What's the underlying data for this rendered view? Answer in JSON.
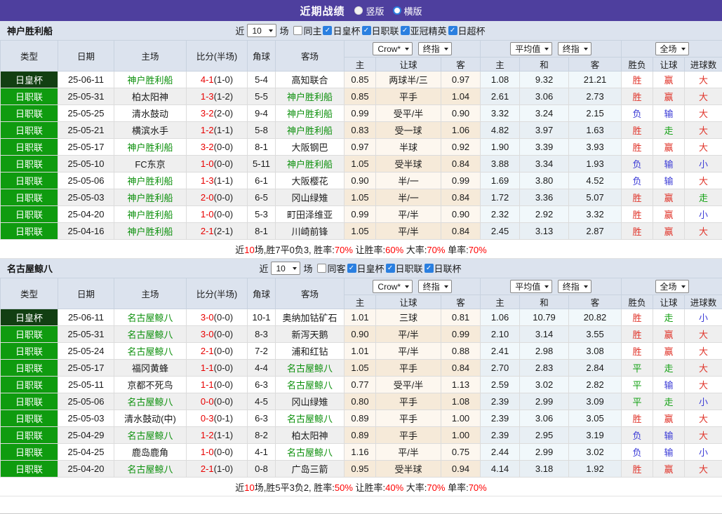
{
  "title": {
    "title": "近期战绩",
    "radios": [
      {
        "label": "竖版",
        "on": true
      },
      {
        "label": "横版",
        "on": false
      }
    ]
  },
  "colors": {
    "purple": "#4e3f9e",
    "hdr": "#dce3ee",
    "cup": "#123f12",
    "lg": "#0f9b0f",
    "team": "#0a8f0a",
    "red": "#e0352b",
    "green": "#13a113",
    "blue": "#3b3bd6",
    "scorered": "#e80000",
    "cbblue": "#2a7fe0",
    "odds1": "#fdf7ef",
    "odds2": "#f6ead9",
    "avg1": "#f1f8fb",
    "avg2": "#e8eff4",
    "rowalt": "#efefef"
  },
  "headers": {
    "main": [
      "类型",
      "日期",
      "主场",
      "比分(半场)",
      "角球",
      "客场"
    ],
    "sub": [
      "主",
      "让球",
      "客",
      "主",
      "和",
      "客",
      "胜负",
      "让球",
      "进球数"
    ],
    "sel_crow": "Crow*",
    "sel_final": "终指",
    "sel_avg": "平均值",
    "sel_scope": "全场"
  },
  "sections": [
    {
      "team": "神户胜利船",
      "filters": {
        "near": "近",
        "count": "10",
        "unit": "场",
        "same": {
          "label": "同主",
          "checked": false
        },
        "leagues": [
          {
            "label": "日皇杯",
            "checked": true
          },
          {
            "label": "日职联",
            "checked": true
          },
          {
            "label": "亚冠精英",
            "checked": true
          },
          {
            "label": "日超杯",
            "checked": true
          }
        ]
      },
      "rows": [
        {
          "type": "日皇杯",
          "tcls": "cup",
          "date": "25-06-11",
          "home": "神户胜利船",
          "hcls": "focus",
          "ft": "4-1",
          "ht": "(1-0)",
          "corner": "5-4",
          "away": "高知联合",
          "acls": "",
          "oh": "0.85",
          "hd": "两球半/三",
          "oa": "0.97",
          "ah": "1.08",
          "ad": "9.32",
          "aa": "21.21",
          "r1": "胜",
          "r1c": "red",
          "r2": "赢",
          "r2c": "red",
          "r3": "大",
          "r3c": "red"
        },
        {
          "type": "日职联",
          "tcls": "league",
          "date": "25-05-31",
          "home": "柏太阳神",
          "hcls": "",
          "ft": "1-3",
          "ht": "(1-2)",
          "corner": "5-5",
          "away": "神户胜利船",
          "acls": "focus",
          "oh": "0.85",
          "hd": "平手",
          "oa": "1.04",
          "ah": "2.61",
          "ad": "3.06",
          "aa": "2.73",
          "r1": "胜",
          "r1c": "red",
          "r2": "赢",
          "r2c": "red",
          "r3": "大",
          "r3c": "red"
        },
        {
          "type": "日职联",
          "tcls": "league",
          "date": "25-05-25",
          "home": "清水鼓动",
          "hcls": "",
          "ft": "3-2",
          "ht": "(2-0)",
          "corner": "9-4",
          "away": "神户胜利船",
          "acls": "focus",
          "oh": "0.99",
          "hd": "受平/半",
          "oa": "0.90",
          "ah": "3.32",
          "ad": "3.24",
          "aa": "2.15",
          "r1": "负",
          "r1c": "blue",
          "r2": "输",
          "r2c": "blue",
          "r3": "大",
          "r3c": "red"
        },
        {
          "type": "日职联",
          "tcls": "league",
          "date": "25-05-21",
          "home": "横滨水手",
          "hcls": "",
          "ft": "1-2",
          "ht": "(1-1)",
          "corner": "5-8",
          "away": "神户胜利船",
          "acls": "focus",
          "oh": "0.83",
          "hd": "受一球",
          "oa": "1.06",
          "ah": "4.82",
          "ad": "3.97",
          "aa": "1.63",
          "r1": "胜",
          "r1c": "red",
          "r2": "走",
          "r2c": "green",
          "r3": "大",
          "r3c": "red"
        },
        {
          "type": "日职联",
          "tcls": "league",
          "date": "25-05-17",
          "home": "神户胜利船",
          "hcls": "focus",
          "ft": "3-2",
          "ht": "(0-0)",
          "corner": "8-1",
          "away": "大阪钢巴",
          "acls": "",
          "oh": "0.97",
          "hd": "半球",
          "oa": "0.92",
          "ah": "1.90",
          "ad": "3.39",
          "aa": "3.93",
          "r1": "胜",
          "r1c": "red",
          "r2": "赢",
          "r2c": "red",
          "r3": "大",
          "r3c": "red"
        },
        {
          "type": "日职联",
          "tcls": "league",
          "date": "25-05-10",
          "home": "FC东京",
          "hcls": "",
          "ft": "1-0",
          "ht": "(0-0)",
          "corner": "5-11",
          "away": "神户胜利船",
          "acls": "focus",
          "oh": "1.05",
          "hd": "受半球",
          "oa": "0.84",
          "ah": "3.88",
          "ad": "3.34",
          "aa": "1.93",
          "r1": "负",
          "r1c": "blue",
          "r2": "输",
          "r2c": "blue",
          "r3": "小",
          "r3c": "blue"
        },
        {
          "type": "日职联",
          "tcls": "league",
          "date": "25-05-06",
          "home": "神户胜利船",
          "hcls": "focus",
          "ft": "1-3",
          "ht": "(1-1)",
          "corner": "6-1",
          "away": "大阪樱花",
          "acls": "",
          "oh": "0.90",
          "hd": "半/一",
          "oa": "0.99",
          "ah": "1.69",
          "ad": "3.80",
          "aa": "4.52",
          "r1": "负",
          "r1c": "blue",
          "r2": "输",
          "r2c": "blue",
          "r3": "大",
          "r3c": "red"
        },
        {
          "type": "日职联",
          "tcls": "league",
          "date": "25-05-03",
          "home": "神户胜利船",
          "hcls": "focus",
          "ft": "2-0",
          "ht": "(0-0)",
          "corner": "6-5",
          "away": "冈山绿雉",
          "acls": "",
          "oh": "1.05",
          "hd": "半/一",
          "oa": "0.84",
          "ah": "1.72",
          "ad": "3.36",
          "aa": "5.07",
          "r1": "胜",
          "r1c": "red",
          "r2": "赢",
          "r2c": "red",
          "r3": "走",
          "r3c": "green"
        },
        {
          "type": "日职联",
          "tcls": "league",
          "date": "25-04-20",
          "home": "神户胜利船",
          "hcls": "focus",
          "ft": "1-0",
          "ht": "(0-0)",
          "corner": "5-3",
          "away": "町田泽维亚",
          "acls": "",
          "oh": "0.99",
          "hd": "平/半",
          "oa": "0.90",
          "ah": "2.32",
          "ad": "2.92",
          "aa": "3.32",
          "r1": "胜",
          "r1c": "red",
          "r2": "赢",
          "r2c": "red",
          "r3": "小",
          "r3c": "blue"
        },
        {
          "type": "日职联",
          "tcls": "league",
          "date": "25-04-16",
          "home": "神户胜利船",
          "hcls": "focus",
          "ft": "2-1",
          "ht": "(2-1)",
          "corner": "8-1",
          "away": "川崎前锋",
          "acls": "",
          "oh": "1.05",
          "hd": "平/半",
          "oa": "0.84",
          "ah": "2.45",
          "ad": "3.13",
          "aa": "2.87",
          "r1": "胜",
          "r1c": "red",
          "r2": "赢",
          "r2c": "red",
          "r3": "大",
          "r3c": "red"
        }
      ],
      "summary": [
        {
          "text": "近"
        },
        {
          "text": "10",
          "red": true
        },
        {
          "text": "场,胜7平0负3, 胜率:"
        },
        {
          "text": "70%",
          "red": true
        },
        {
          "text": " 让胜率:"
        },
        {
          "text": "60%",
          "red": true
        },
        {
          "text": " 大率:"
        },
        {
          "text": "70%",
          "red": true
        },
        {
          "text": " 单率:"
        },
        {
          "text": "70%",
          "red": true
        }
      ]
    },
    {
      "team": "名古屋鲸八",
      "filters": {
        "near": "近",
        "count": "10",
        "unit": "场",
        "same": {
          "label": "同客",
          "checked": false
        },
        "leagues": [
          {
            "label": "日皇杯",
            "checked": true
          },
          {
            "label": "日职联",
            "checked": true
          },
          {
            "label": "日联杯",
            "checked": true
          }
        ]
      },
      "rows": [
        {
          "type": "日皇杯",
          "tcls": "cup",
          "date": "25-06-11",
          "home": "名古屋鲸八",
          "hcls": "focus",
          "ft": "3-0",
          "ht": "(0-0)",
          "corner": "10-1",
          "away": "奥纳加钴矿石",
          "acls": "",
          "oh": "1.01",
          "hd": "三球",
          "oa": "0.81",
          "ah": "1.06",
          "ad": "10.79",
          "aa": "20.82",
          "r1": "胜",
          "r1c": "red",
          "r2": "走",
          "r2c": "green",
          "r3": "小",
          "r3c": "blue"
        },
        {
          "type": "日职联",
          "tcls": "league",
          "date": "25-05-31",
          "home": "名古屋鲸八",
          "hcls": "focus",
          "ft": "3-0",
          "ht": "(0-0)",
          "corner": "8-3",
          "away": "新泻天鹅",
          "acls": "",
          "oh": "0.90",
          "hd": "平/半",
          "oa": "0.99",
          "ah": "2.10",
          "ad": "3.14",
          "aa": "3.55",
          "r1": "胜",
          "r1c": "red",
          "r2": "赢",
          "r2c": "red",
          "r3": "大",
          "r3c": "red"
        },
        {
          "type": "日职联",
          "tcls": "league",
          "date": "25-05-24",
          "home": "名古屋鲸八",
          "hcls": "focus",
          "ft": "2-1",
          "ht": "(0-0)",
          "corner": "7-2",
          "away": "浦和红钻",
          "acls": "",
          "oh": "1.01",
          "hd": "平/半",
          "oa": "0.88",
          "ah": "2.41",
          "ad": "2.98",
          "aa": "3.08",
          "r1": "胜",
          "r1c": "red",
          "r2": "赢",
          "r2c": "red",
          "r3": "大",
          "r3c": "red"
        },
        {
          "type": "日职联",
          "tcls": "league",
          "date": "25-05-17",
          "home": "福冈黄蜂",
          "hcls": "",
          "ft": "1-1",
          "ht": "(0-0)",
          "corner": "4-4",
          "away": "名古屋鲸八",
          "acls": "focus",
          "oh": "1.05",
          "hd": "平手",
          "oa": "0.84",
          "ah": "2.70",
          "ad": "2.83",
          "aa": "2.84",
          "r1": "平",
          "r1c": "green",
          "r2": "走",
          "r2c": "green",
          "r3": "大",
          "r3c": "red"
        },
        {
          "type": "日职联",
          "tcls": "league",
          "date": "25-05-11",
          "home": "京都不死鸟",
          "hcls": "",
          "ft": "1-1",
          "ht": "(0-0)",
          "corner": "6-3",
          "away": "名古屋鲸八",
          "acls": "focus",
          "oh": "0.77",
          "hd": "受平/半",
          "oa": "1.13",
          "ah": "2.59",
          "ad": "3.02",
          "aa": "2.82",
          "r1": "平",
          "r1c": "green",
          "r2": "输",
          "r2c": "blue",
          "r3": "大",
          "r3c": "red"
        },
        {
          "type": "日职联",
          "tcls": "league",
          "date": "25-05-06",
          "home": "名古屋鲸八",
          "hcls": "focus",
          "ft": "0-0",
          "ht": "(0-0)",
          "corner": "4-5",
          "away": "冈山绿雉",
          "acls": "",
          "oh": "0.80",
          "hd": "平手",
          "oa": "1.08",
          "ah": "2.39",
          "ad": "2.99",
          "aa": "3.09",
          "r1": "平",
          "r1c": "green",
          "r2": "走",
          "r2c": "green",
          "r3": "小",
          "r3c": "blue"
        },
        {
          "type": "日职联",
          "tcls": "league",
          "date": "25-05-03",
          "home": "清水鼓动(中)",
          "hcls": "",
          "ft": "0-3",
          "ht": "(0-1)",
          "corner": "6-3",
          "away": "名古屋鲸八",
          "acls": "focus",
          "oh": "0.89",
          "hd": "平手",
          "oa": "1.00",
          "ah": "2.39",
          "ad": "3.06",
          "aa": "3.05",
          "r1": "胜",
          "r1c": "red",
          "r2": "赢",
          "r2c": "red",
          "r3": "大",
          "r3c": "red"
        },
        {
          "type": "日职联",
          "tcls": "league",
          "date": "25-04-29",
          "home": "名古屋鲸八",
          "hcls": "focus",
          "ft": "1-2",
          "ht": "(1-1)",
          "corner": "8-2",
          "away": "柏太阳神",
          "acls": "",
          "oh": "0.89",
          "hd": "平手",
          "oa": "1.00",
          "ah": "2.39",
          "ad": "2.95",
          "aa": "3.19",
          "r1": "负",
          "r1c": "blue",
          "r2": "输",
          "r2c": "blue",
          "r3": "大",
          "r3c": "red"
        },
        {
          "type": "日职联",
          "tcls": "league",
          "date": "25-04-25",
          "home": "鹿岛鹿角",
          "hcls": "",
          "ft": "1-0",
          "ht": "(0-0)",
          "corner": "4-1",
          "away": "名古屋鲸八",
          "acls": "focus",
          "oh": "1.16",
          "hd": "平/半",
          "oa": "0.75",
          "ah": "2.44",
          "ad": "2.99",
          "aa": "3.02",
          "r1": "负",
          "r1c": "blue",
          "r2": "输",
          "r2c": "blue",
          "r3": "小",
          "r3c": "blue"
        },
        {
          "type": "日职联",
          "tcls": "league",
          "date": "25-04-20",
          "home": "名古屋鲸八",
          "hcls": "focus",
          "ft": "2-1",
          "ht": "(1-0)",
          "corner": "0-8",
          "away": "广岛三箭",
          "acls": "",
          "oh": "0.95",
          "hd": "受半球",
          "oa": "0.94",
          "ah": "4.14",
          "ad": "3.18",
          "aa": "1.92",
          "r1": "胜",
          "r1c": "red",
          "r2": "赢",
          "r2c": "red",
          "r3": "大",
          "r3c": "red"
        }
      ],
      "summary": [
        {
          "text": "近"
        },
        {
          "text": "10",
          "red": true
        },
        {
          "text": "场,胜5平3负2, 胜率:"
        },
        {
          "text": "50%",
          "red": true
        },
        {
          "text": " 让胜率:"
        },
        {
          "text": "40%",
          "red": true
        },
        {
          "text": " 大率:"
        },
        {
          "text": "70%",
          "red": true
        },
        {
          "text": " 单率:"
        },
        {
          "text": "70%",
          "red": true
        }
      ]
    }
  ]
}
